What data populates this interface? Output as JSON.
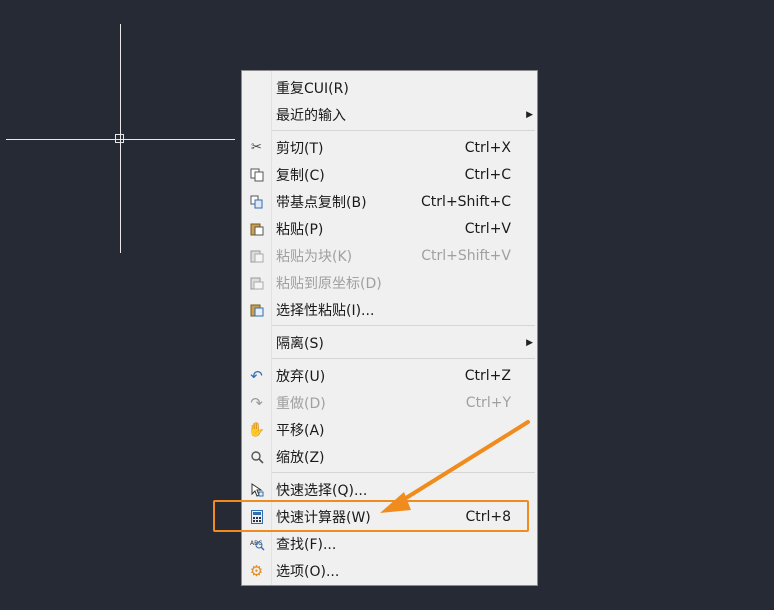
{
  "menu": {
    "items": [
      {
        "id": "repeat-cui",
        "label": "重复CUI(R)",
        "shortcut": "",
        "icon": "none",
        "disabled": false,
        "submenu": false
      },
      {
        "id": "recent-input",
        "label": "最近的输入",
        "shortcut": "",
        "icon": "none",
        "disabled": false,
        "submenu": true
      },
      {
        "id": "cut",
        "label": "剪切(T)",
        "shortcut": "Ctrl+X",
        "icon": "scissors-icon",
        "disabled": false,
        "submenu": false
      },
      {
        "id": "copy",
        "label": "复制(C)",
        "shortcut": "Ctrl+C",
        "icon": "copy-icon",
        "disabled": false,
        "submenu": false
      },
      {
        "id": "copy-base",
        "label": "带基点复制(B)",
        "shortcut": "Ctrl+Shift+C",
        "icon": "copy-base-point-icon",
        "disabled": false,
        "submenu": false
      },
      {
        "id": "paste",
        "label": "粘贴(P)",
        "shortcut": "Ctrl+V",
        "icon": "paste-icon",
        "disabled": false,
        "submenu": false
      },
      {
        "id": "paste-block",
        "label": "粘贴为块(K)",
        "shortcut": "Ctrl+Shift+V",
        "icon": "paste-block-icon",
        "disabled": true,
        "submenu": false
      },
      {
        "id": "paste-orig",
        "label": "粘贴到原坐标(D)",
        "shortcut": "",
        "icon": "paste-original-icon",
        "disabled": true,
        "submenu": false
      },
      {
        "id": "paste-special",
        "label": "选择性粘贴(I)...",
        "shortcut": "",
        "icon": "paste-special-icon",
        "disabled": false,
        "submenu": false
      },
      {
        "id": "isolate",
        "label": "隔离(S)",
        "shortcut": "",
        "icon": "none",
        "disabled": false,
        "submenu": true
      },
      {
        "id": "undo",
        "label": "放弃(U)",
        "shortcut": "Ctrl+Z",
        "icon": "undo-icon",
        "disabled": false,
        "submenu": false
      },
      {
        "id": "redo",
        "label": "重做(D)",
        "shortcut": "Ctrl+Y",
        "icon": "redo-icon",
        "disabled": true,
        "submenu": false
      },
      {
        "id": "pan",
        "label": "平移(A)",
        "shortcut": "",
        "icon": "hand-icon",
        "disabled": false,
        "submenu": false
      },
      {
        "id": "zoom",
        "label": "缩放(Z)",
        "shortcut": "",
        "icon": "zoom-icon",
        "disabled": false,
        "submenu": false
      },
      {
        "id": "quick-select",
        "label": "快速选择(Q)...",
        "shortcut": "",
        "icon": "quick-select-icon",
        "disabled": false,
        "submenu": false
      },
      {
        "id": "quick-calc",
        "label": "快速计算器(W)",
        "shortcut": "Ctrl+8",
        "icon": "calculator-icon",
        "disabled": false,
        "submenu": false
      },
      {
        "id": "find",
        "label": "查找(F)...",
        "shortcut": "",
        "icon": "find-abc-icon",
        "disabled": false,
        "submenu": false
      },
      {
        "id": "options",
        "label": "选项(O)...",
        "shortcut": "",
        "icon": "gear-icon",
        "disabled": false,
        "submenu": false
      }
    ]
  },
  "colors": {
    "canvas_bg": "#252a34",
    "menu_bg": "#f0f0f0",
    "highlight": "#f08c1e"
  }
}
